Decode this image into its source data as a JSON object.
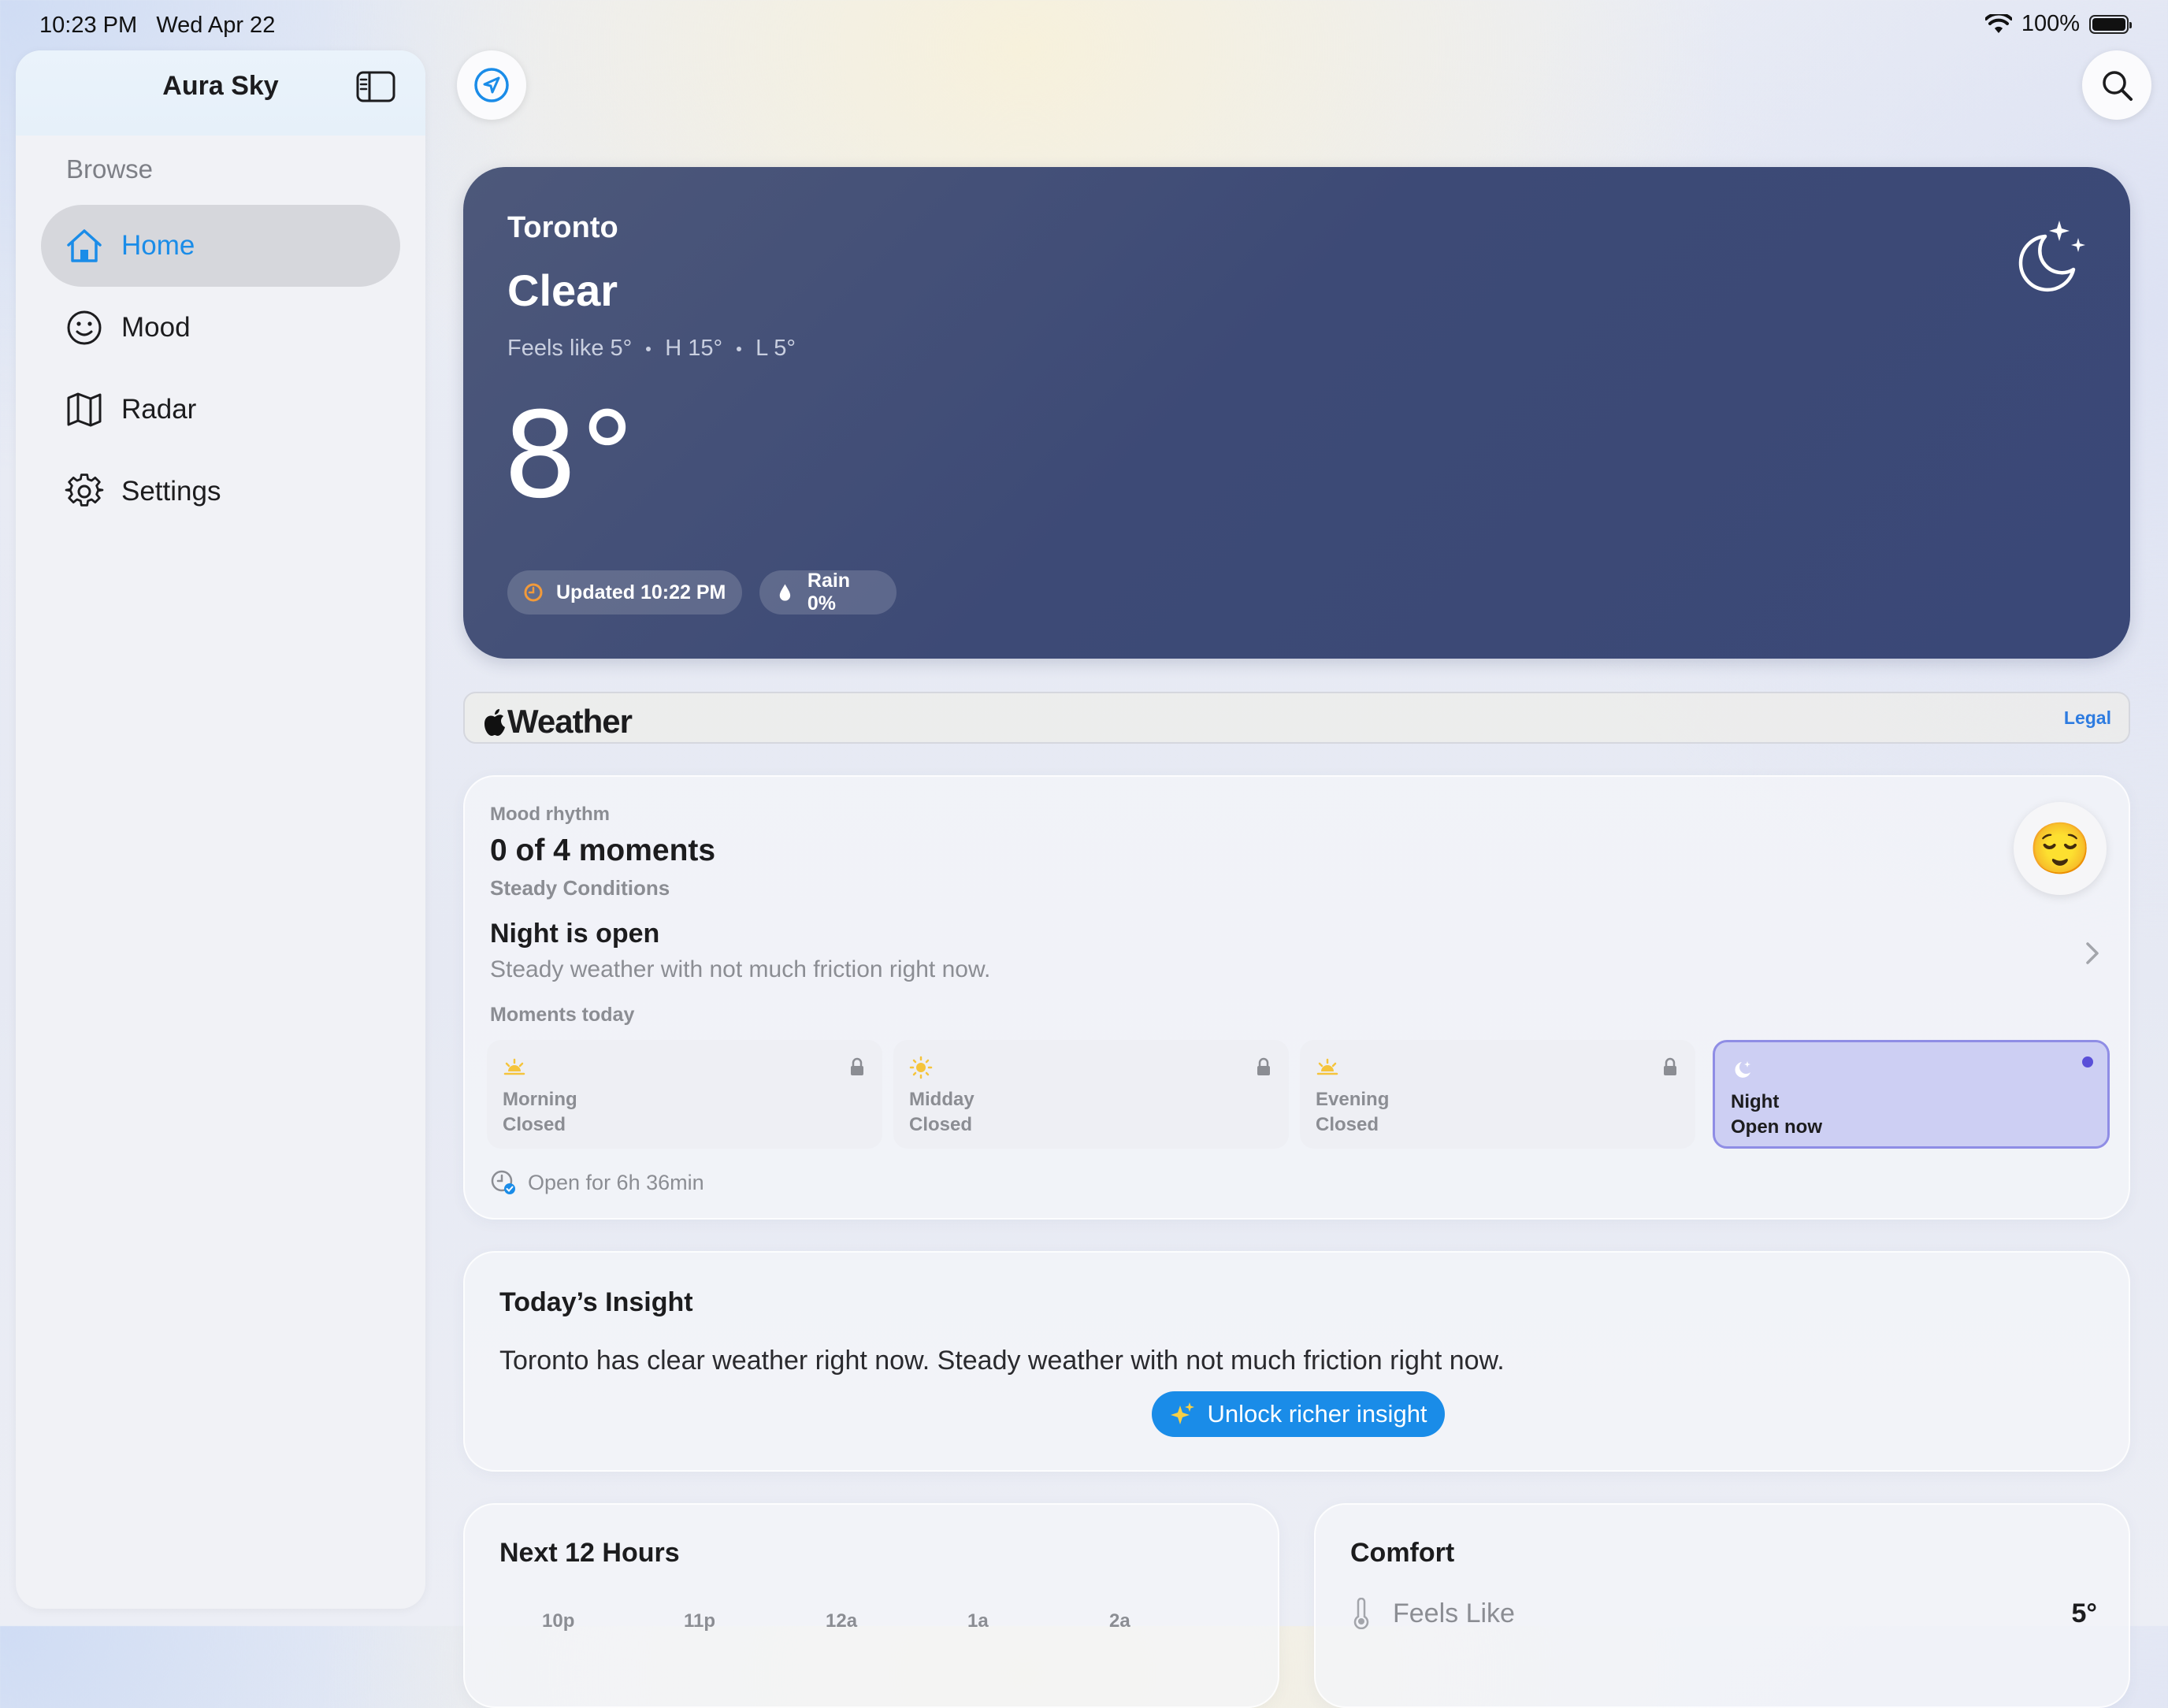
{
  "status_bar": {
    "time": "10:23 PM",
    "date": "Wed Apr 22",
    "battery": "100%",
    "battery_level": 1.0
  },
  "sidebar": {
    "title": "Aura Sky",
    "section": "Browse",
    "items": [
      {
        "label": "Home",
        "icon": "house-icon",
        "active": true
      },
      {
        "label": "Mood",
        "icon": "smiley-icon",
        "active": false
      },
      {
        "label": "Radar",
        "icon": "map-icon",
        "active": false
      },
      {
        "label": "Settings",
        "icon": "gear-icon",
        "active": false
      }
    ]
  },
  "hero": {
    "city": "Toronto",
    "condition": "Clear",
    "feels_like": "Feels like 5°",
    "high": "H 15°",
    "low": "L 5°",
    "temperature": "8°",
    "updated": "Updated 10:22 PM",
    "rain": "Rain 0%",
    "icon": "moon-stars-icon"
  },
  "attribution": {
    "brand": "Weather",
    "legal": "Legal"
  },
  "mood": {
    "eyebrow": "Mood rhythm",
    "count": "0 of 4 moments",
    "state": "Steady Conditions",
    "headline": "Night is open",
    "description": "Steady weather with not much friction right now.",
    "moments_label": "Moments today",
    "emoji": "😌",
    "moments": [
      {
        "name": "Morning",
        "status": "Closed",
        "icon": "sunrise-icon",
        "locked": true
      },
      {
        "name": "Midday",
        "status": "Closed",
        "icon": "sun-icon",
        "locked": true
      },
      {
        "name": "Evening",
        "status": "Closed",
        "icon": "sunset-icon",
        "locked": true
      },
      {
        "name": "Night",
        "status": "Open now",
        "icon": "moon-icon",
        "locked": false
      }
    ],
    "open_for": "Open for 6h 36min"
  },
  "insight": {
    "title": "Today’s Insight",
    "body": "Toronto has clear weather right now. Steady weather with not much friction right now.",
    "cta": "Unlock richer insight"
  },
  "next_hours": {
    "title": "Next 12 Hours",
    "hours": [
      "10p",
      "11p",
      "12a",
      "1a",
      "2a"
    ]
  },
  "comfort": {
    "title": "Comfort",
    "rows": [
      {
        "label": "Feels Like",
        "value": "5°"
      }
    ]
  },
  "colors": {
    "accent": "#1a8ce8",
    "hero_bg": "#3d4a76",
    "night_active": "#cdcff3"
  }
}
